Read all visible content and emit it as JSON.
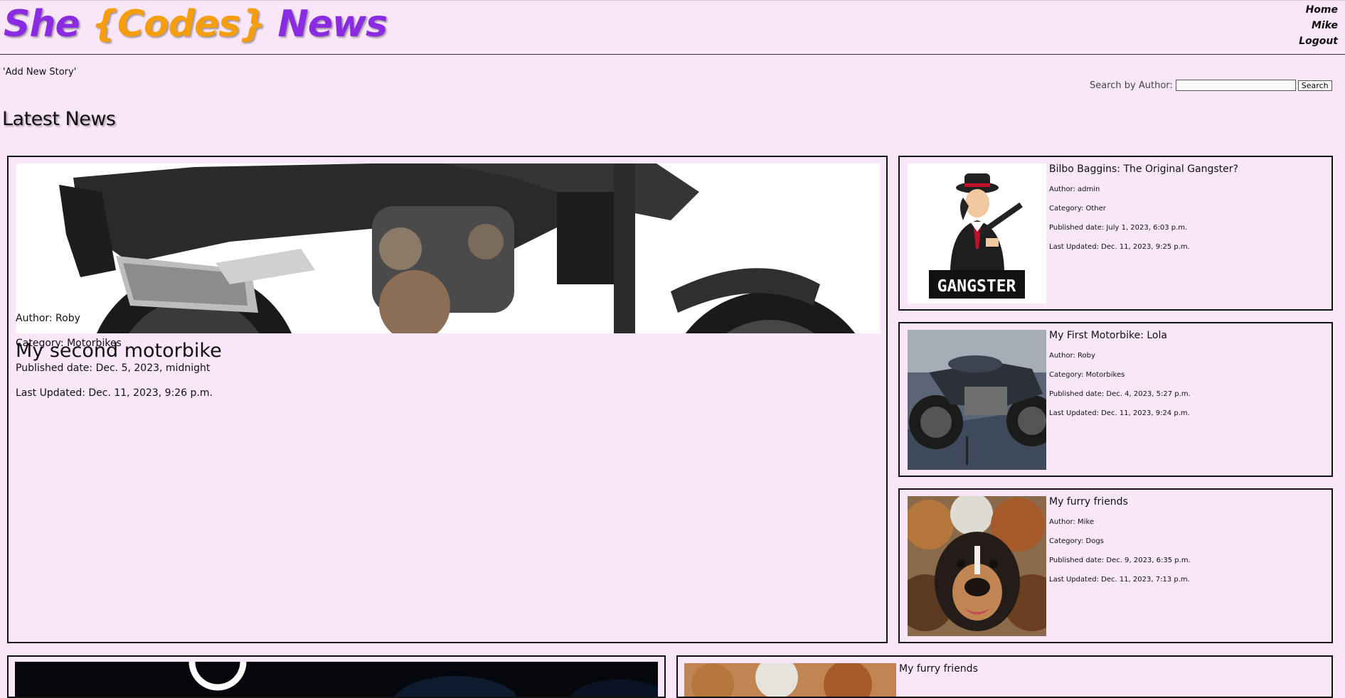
{
  "brand": {
    "word1": "She",
    "word2": "{Codes}",
    "word3": "News"
  },
  "nav": {
    "home": "Home",
    "user": "Mike",
    "logout": "Logout"
  },
  "add_story": "'Add New Story'",
  "search": {
    "label": "Search by Author:",
    "value": "",
    "button": "Search"
  },
  "section_title": "Latest News",
  "featured": {
    "title": "My second motorbike",
    "author": "Author: Roby",
    "category": "Category: Motorbikes",
    "published": "Published date: Dec. 5, 2023, midnight",
    "updated": "Last Updated: Dec. 11, 2023, 9:26 p.m."
  },
  "side_stories": [
    {
      "title": "Bilbo Baggins: The Original Gangster?",
      "author": "Author: admin",
      "category": "Category: Other",
      "published": "Published date: July 1, 2023, 6:03 p.m.",
      "updated": "Last Updated: Dec. 11, 2023, 9:25 p.m.",
      "image_text": "GANGSTER"
    },
    {
      "title": "My First Motorbike: Lola",
      "author": "Author: Roby",
      "category": "Category: Motorbikes",
      "published": "Published date: Dec. 4, 2023, 5:27 p.m.",
      "updated": "Last Updated: Dec. 11, 2023, 9:24 p.m."
    },
    {
      "title": "My furry friends",
      "author": "Author: Mike",
      "category": "Category: Dogs",
      "published": "Published date: Dec. 9, 2023, 6:35 p.m.",
      "updated": "Last Updated: Dec. 11, 2023, 7:13 p.m."
    }
  ],
  "bottom_right_title": "My furry friends",
  "colors": {
    "background": "#f9e6f9",
    "brand_purple": "#8a2be2",
    "brand_orange": "#f59d0b"
  }
}
